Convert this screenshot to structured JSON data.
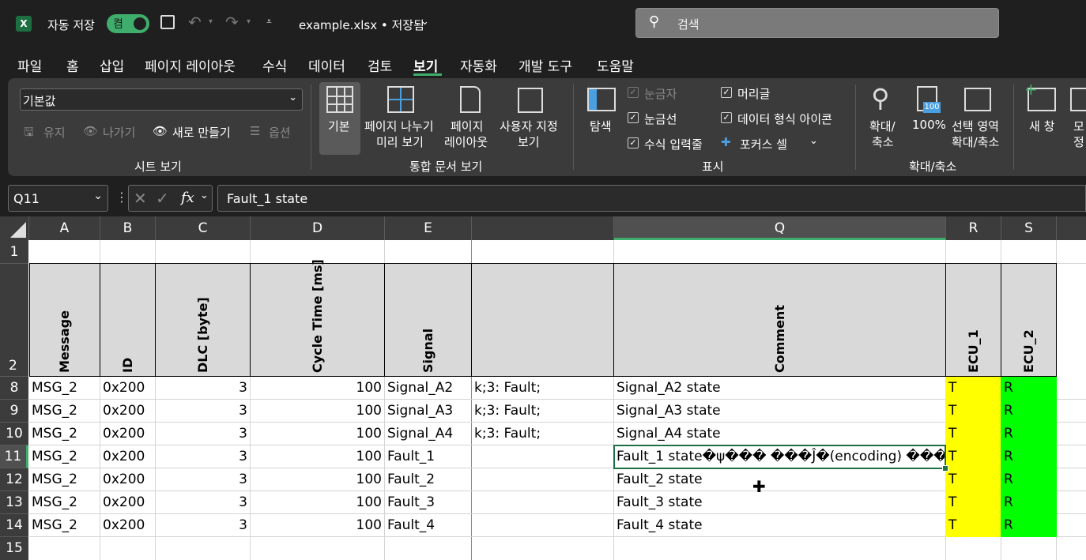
{
  "titlebar": {
    "autosave_label": "자동 저장",
    "autosave_state": "켬",
    "filename": "example.xlsx • 저장됨",
    "search_placeholder": "검색"
  },
  "menu": [
    "파일",
    "홈",
    "삽입",
    "페이지 레이아웃",
    "수식",
    "데이터",
    "검토",
    "보기",
    "자동화",
    "개발 도구",
    "도움말"
  ],
  "active_menu": "보기",
  "ribbon": {
    "sheet_view": {
      "dropdown_value": "기본값",
      "keep": "유지",
      "exit": "나가기",
      "new": "새로 만들기",
      "options": "옵션",
      "group_label": "시트 보기"
    },
    "workbook_views": {
      "normal": "기본",
      "page_break_1": "페이지 나누기",
      "page_break_2": "미리 보기",
      "page_layout_1": "페이지",
      "page_layout_2": "레이아웃",
      "custom_1": "사용자 지정",
      "custom_2": "보기",
      "group_label": "통합 문서 보기"
    },
    "show": {
      "navigation": "탐색",
      "ruler": "눈금자",
      "gridlines": "눈금선",
      "formula_bar": "수식 입력줄",
      "headings": "머리글",
      "data_type_icons": "데이터 형식 아이콘",
      "focus_cell": "포커스 셀",
      "group_label": "표시"
    },
    "zoom": {
      "zoom_1": "확대/",
      "zoom_2": "축소",
      "hundred": "100%",
      "zoom_sel_1": "선택 영역",
      "zoom_sel_2": "확대/축소",
      "group_label": "확대/축소"
    },
    "window": {
      "new_window": "새 창",
      "partial_1": "모",
      "partial_2": "정"
    }
  },
  "formula_bar": {
    "name_box": "Q11",
    "fx": "fx",
    "content": "Fault_1 state"
  },
  "columns": [
    "A",
    "B",
    "C",
    "D",
    "E",
    "Q",
    "R",
    "S"
  ],
  "row_numbers": [
    "1",
    "2",
    "8",
    "9",
    "10",
    "11",
    "12",
    "13",
    "14",
    "15"
  ],
  "headers": {
    "A": "Message",
    "B": "ID",
    "C": "DLC [byte]",
    "D": "Cycle Time [ms]",
    "E": "Signal",
    "Q": "Comment",
    "R": "ECU_1",
    "S": "ECU_2"
  },
  "rows": [
    {
      "row": "8",
      "A": "MSG_2",
      "B": "0x200",
      "C": "3",
      "D": "100",
      "E": "Signal_A2",
      "F": "k;3: Fault;",
      "Q": "Signal_A2 state",
      "R": "T",
      "S": "R"
    },
    {
      "row": "9",
      "A": "MSG_2",
      "B": "0x200",
      "C": "3",
      "D": "100",
      "E": "Signal_A3",
      "F": "k;3: Fault;",
      "Q": "Signal_A3 state",
      "R": "T",
      "S": "R"
    },
    {
      "row": "10",
      "A": "MSG_2",
      "B": "0x200",
      "C": "3",
      "D": "100",
      "E": "Signal_A4",
      "F": "k;3: Fault;",
      "Q": "Signal_A4 state",
      "R": "T",
      "S": "R"
    },
    {
      "row": "11",
      "A": "MSG_2",
      "B": "0x200",
      "C": "3",
      "D": "100",
      "E": "Fault_1",
      "F": "",
      "Q": "Fault_1 state�ψ��� ���Ĵ�(encoding) ���",
      "R": "T",
      "S": "R"
    },
    {
      "row": "12",
      "A": "MSG_2",
      "B": "0x200",
      "C": "3",
      "D": "100",
      "E": "Fault_2",
      "F": "",
      "Q": "Fault_2 state",
      "R": "T",
      "S": "R"
    },
    {
      "row": "13",
      "A": "MSG_2",
      "B": "0x200",
      "C": "3",
      "D": "100",
      "E": "Fault_3",
      "F": "",
      "Q": "Fault_3 state",
      "R": "T",
      "S": "R"
    },
    {
      "row": "14",
      "A": "MSG_2",
      "B": "0x200",
      "C": "3",
      "D": "100",
      "E": "Fault_4",
      "F": "",
      "Q": "Fault_4 state",
      "R": "T",
      "S": "R"
    }
  ],
  "colors": {
    "ecu1_fill": "#ffff00",
    "ecu2_fill": "#00ff00",
    "header_fill": "#d9d9d9",
    "autosave_on": "#3fae6c",
    "active_cell_border": "#1e7145"
  }
}
